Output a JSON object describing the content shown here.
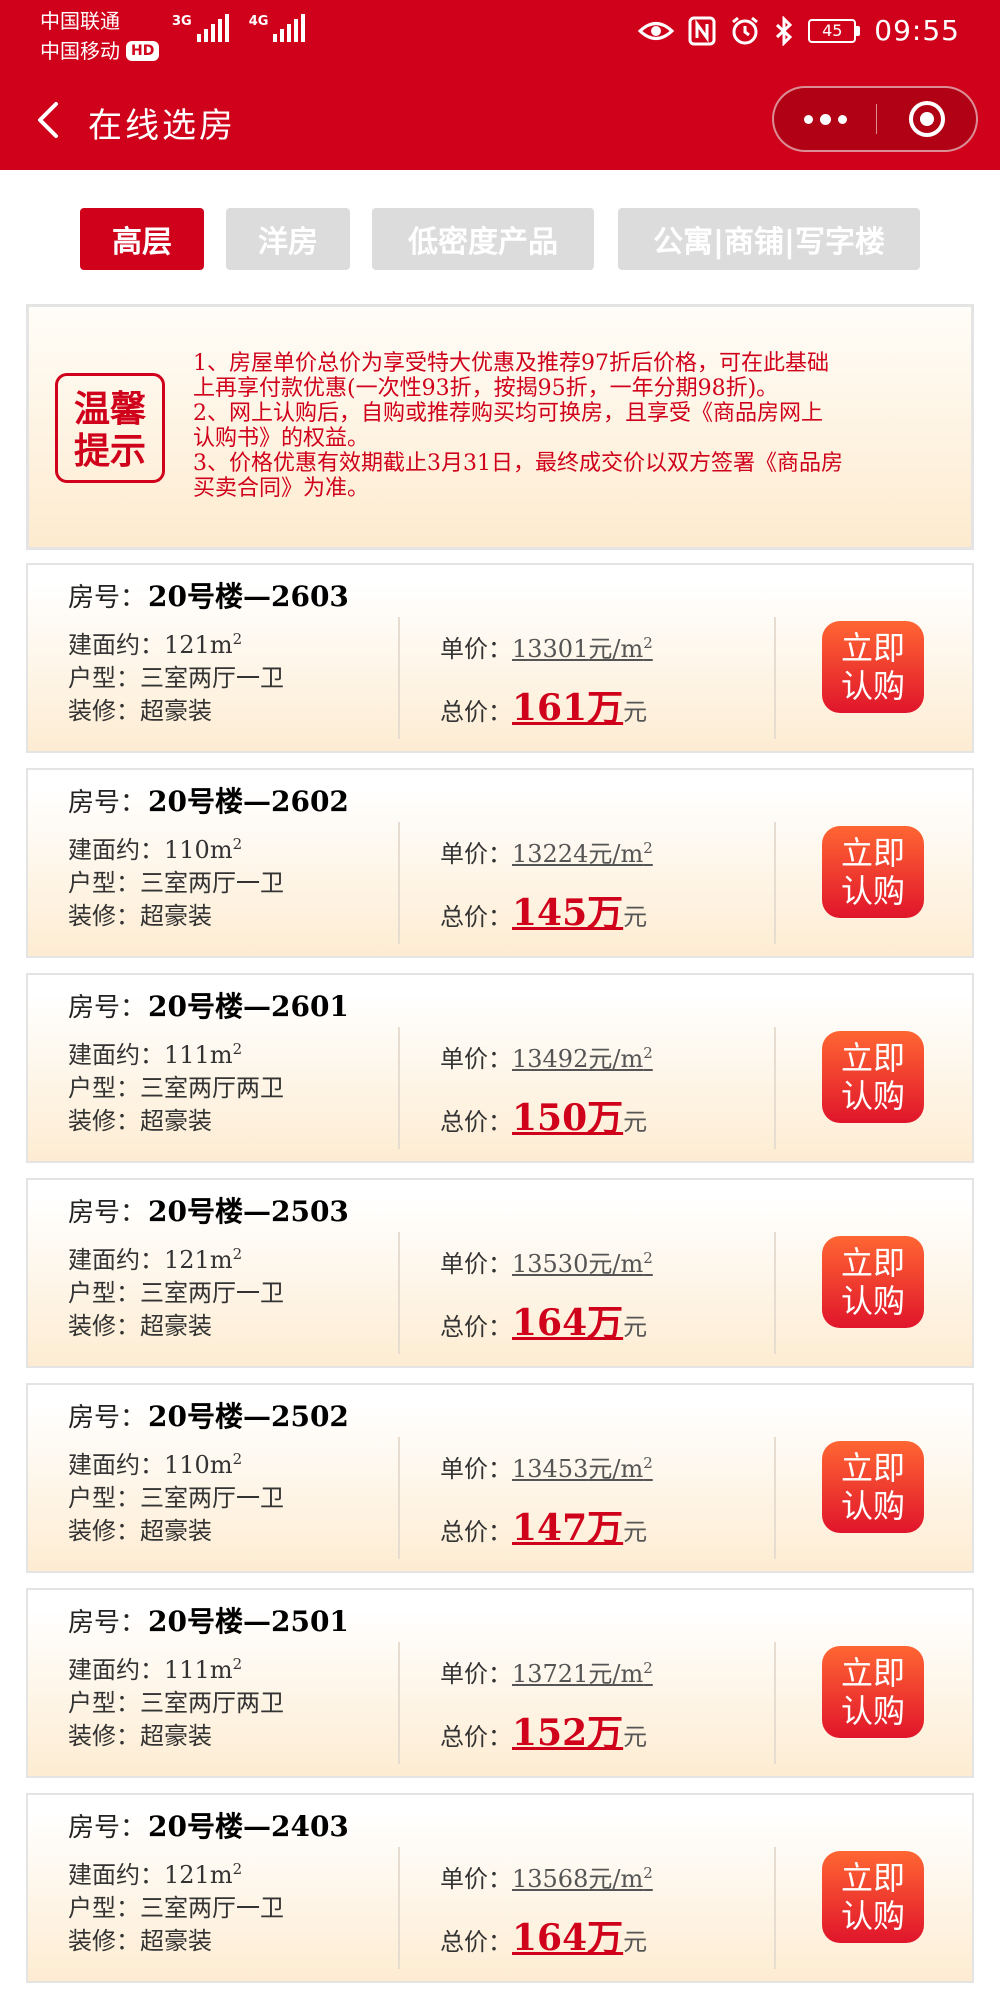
{
  "status_bar": {
    "carrier_1": "中国联通",
    "carrier_2": "中国移动",
    "hd_badge": "HD",
    "network_1": "3G",
    "network_2": "4G",
    "battery": "45",
    "time": "09:55"
  },
  "nav": {
    "title": "在线选房"
  },
  "tabs": [
    {
      "label": "高层",
      "active": true
    },
    {
      "label": "洋房",
      "active": false
    },
    {
      "label": "低密度产品",
      "active": false
    },
    {
      "label": "公寓|商铺|写字楼",
      "active": false
    }
  ],
  "notice": {
    "seal_line_1": "温馨",
    "seal_line_2": "提示",
    "lines": [
      "1、房屋单价总价为享受特大优惠及推荐97折后价格，可在此基础",
      "上再享付款优惠(一次性93折，按揭95折，一年分期98折)。",
      "2、网上认购后，自购或推荐购买均可换房，且享受《商品房网上",
      "认购书》的权益。",
      "3、价格优惠有效期截止3月31日，最终成交价以双方签署《商品房",
      "买卖合同》为准。"
    ]
  },
  "labels": {
    "room_no": "房号：",
    "area": "建面约：",
    "layout": "户型：",
    "decoration": "装修：",
    "unit_price": "单价：",
    "total_price": "总价：",
    "area_unit": "m",
    "area_sup": "2",
    "price_unit": "元/m",
    "price_sup": "2",
    "total_unit": "元",
    "buy_line_1": "立即",
    "buy_line_2": "认购"
  },
  "listings": [
    {
      "room": "20号楼—2603",
      "area": "121",
      "layout": "三室两厅一卫",
      "decoration": "超豪装",
      "unit_price": "13301",
      "total": "161万"
    },
    {
      "room": "20号楼—2602",
      "area": "110",
      "layout": "三室两厅一卫",
      "decoration": "超豪装",
      "unit_price": "13224",
      "total": "145万"
    },
    {
      "room": "20号楼—2601",
      "area": "111",
      "layout": "三室两厅两卫",
      "decoration": "超豪装",
      "unit_price": "13492",
      "total": "150万"
    },
    {
      "room": "20号楼—2503",
      "area": "121",
      "layout": "三室两厅一卫",
      "decoration": "超豪装",
      "unit_price": "13530",
      "total": "164万"
    },
    {
      "room": "20号楼—2502",
      "area": "110",
      "layout": "三室两厅一卫",
      "decoration": "超豪装",
      "unit_price": "13453",
      "total": "147万"
    },
    {
      "room": "20号楼—2501",
      "area": "111",
      "layout": "三室两厅两卫",
      "decoration": "超豪装",
      "unit_price": "13721",
      "total": "152万"
    },
    {
      "room": "20号楼—2403",
      "area": "121",
      "layout": "三室两厅一卫",
      "decoration": "超豪装",
      "unit_price": "13568",
      "total": "164万"
    }
  ],
  "colors": {
    "brand_red": "#d0021b",
    "button_orange": "#ff6633",
    "tab_inactive": "#dcdcdc"
  },
  "icons": [
    "eye-icon",
    "nfc-icon",
    "alarm-icon",
    "bluetooth-icon",
    "battery-icon",
    "back-arrow-icon",
    "more-icon",
    "close-circle-icon"
  ]
}
